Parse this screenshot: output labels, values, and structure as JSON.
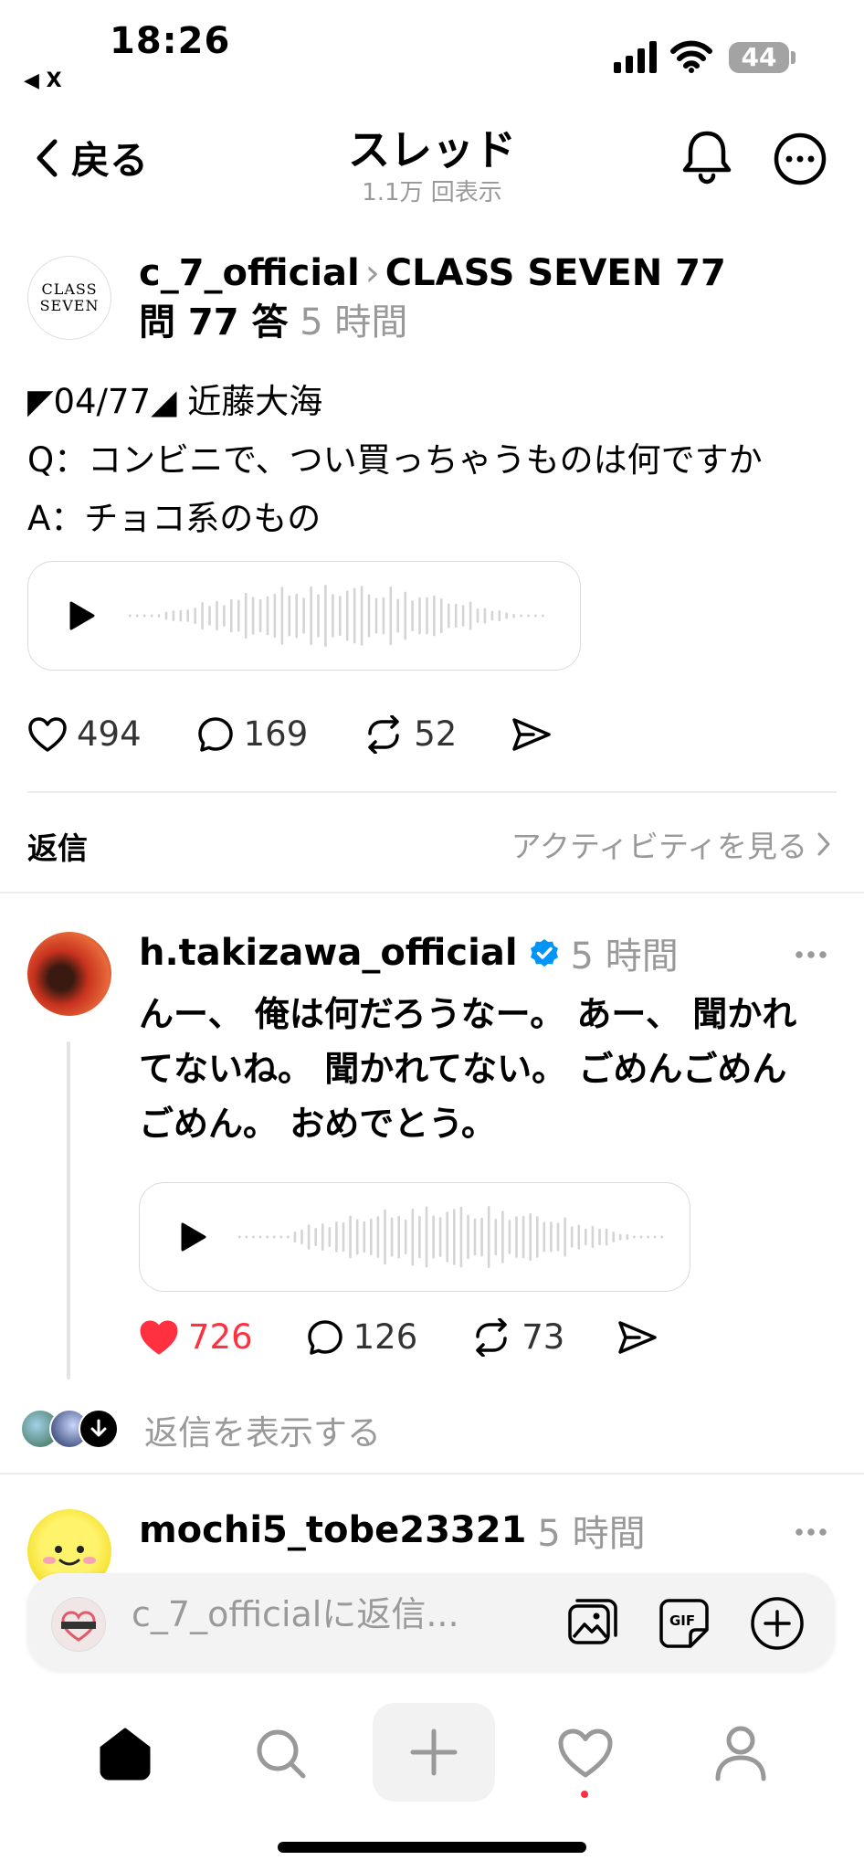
{
  "status_bar": {
    "time": "18:26",
    "back_app": "◀ X",
    "battery": "44"
  },
  "nav": {
    "back_label": "戻る",
    "title": "スレッド",
    "views": "1.1万 回表示"
  },
  "post": {
    "avatar_text_top": "CLASS",
    "avatar_text_bottom": "SEVEN",
    "username": "c_7_official",
    "breadcrumb": "›",
    "community": "CLASS SEVEN 77",
    "community_suffix": "問 77 答",
    "time": "5 時間",
    "lines": [
      "◤04/77◢ 近藤大海",
      "Q：コンビニで、つい買っちゃうものは何ですか",
      "A：チョコ系のもの"
    ],
    "likes": "494",
    "comments": "169",
    "reposts": "52"
  },
  "replies_section": {
    "label": "返信",
    "activity_link": "アクティビティを見る"
  },
  "reply": {
    "username": "h.takizawa_official",
    "time": "5 時間",
    "text": "んー、 俺は何だろうなー。 あー、 聞かれてないね。 聞かれてない。 ごめんごめんごめん。 おめでとう。",
    "likes": "726",
    "comments": "126",
    "reposts": "73",
    "show_replies": "返信を表示する"
  },
  "next_reply": {
    "username": "mochi5_tobe23321",
    "time": "5 時間"
  },
  "composer": {
    "placeholder": "c_7_officialに返信..."
  },
  "colors": {
    "like_red": "#ff3040",
    "verified_blue": "#0095f6",
    "muted_gray": "#999999"
  },
  "icons": {
    "tabs": [
      "home-icon",
      "search-icon",
      "plus-icon",
      "heart-icon",
      "profile-icon"
    ],
    "composer": [
      "image-icon",
      "gif-icon",
      "add-circle-icon"
    ]
  }
}
